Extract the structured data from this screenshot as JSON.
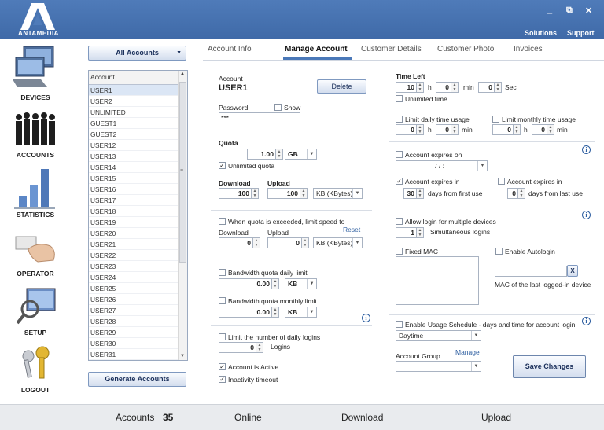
{
  "brand": {
    "logo_text": "ANTAMEDIA"
  },
  "window": {
    "minimize": "_",
    "restore": "⧉",
    "close": "✕"
  },
  "topnav": {
    "solutions": "Solutions",
    "support": "Support"
  },
  "sidebar": {
    "items": [
      {
        "label": "DEVICES",
        "icon": "computers-icon"
      },
      {
        "label": "ACCOUNTS",
        "icon": "people-icon"
      },
      {
        "label": "STATISTICS",
        "icon": "bar-chart-icon"
      },
      {
        "label": "OPERATOR",
        "icon": "hand-card-icon"
      },
      {
        "label": "SETUP",
        "icon": "magnifier-monitor-icon"
      },
      {
        "label": "LOGOUT",
        "icon": "keys-icon"
      }
    ]
  },
  "accounts": {
    "filter": "All Accounts",
    "column": "Account",
    "rows": [
      "USER1",
      "USER2",
      "UNLIMITED",
      "GUEST1",
      "GUEST2",
      "USER12",
      "USER13",
      "USER14",
      "USER15",
      "USER16",
      "USER17",
      "USER18",
      "USER19",
      "USER20",
      "USER21",
      "USER22",
      "USER23",
      "USER24",
      "USER25",
      "USER26",
      "USER27",
      "USER28",
      "USER29",
      "USER30",
      "USER31"
    ],
    "selected_index": 0,
    "generate": "Generate Accounts"
  },
  "tabs": [
    "Account Info",
    "Manage Account",
    "Customer Details",
    "Customer Photo",
    "Invoices"
  ],
  "form": {
    "account_label": "Account",
    "account_value": "USER1",
    "delete": "Delete",
    "password_label": "Password",
    "show_label": "Show",
    "password_value": "***",
    "quota_label": "Quota",
    "quota_value": "1.00",
    "quota_unit": "GB",
    "unlimited_quota": "Unlimited quota",
    "download_label": "Download",
    "upload_label": "Upload",
    "download_value": "100",
    "upload_value": "100",
    "speed_unit": "KB (KBytes)",
    "limit_speed": "When quota is exceeded, limit speed to",
    "reset": "Reset",
    "dl_label2": "Download",
    "ul_label2": "Upload",
    "dl_value2": "0",
    "ul_value2": "0",
    "speed_unit2": "KB (KBytes)",
    "bw_daily": "Bandwidth quota daily limit",
    "bw_daily_value": "0.00",
    "bw_daily_unit": "KB",
    "bw_monthly": "Bandwidth quota monthly limit",
    "bw_monthly_value": "0.00",
    "bw_monthly_unit": "KB",
    "limit_logins": "Limit the number of daily logins",
    "logins_value": "0",
    "logins_label": "Logins",
    "active": "Account is Active",
    "inactivity": "Inactivity timeout"
  },
  "right": {
    "time_left": "Time Left",
    "hours": "10",
    "h": "h",
    "mins": "0",
    "min": "min",
    "secs": "0",
    "sec": "Sec",
    "unlimited_time": "Unlimited time",
    "limit_daily": "Limit daily time usage",
    "limit_monthly": "Limit monthly time usage",
    "d_h": "0",
    "d_m": "0",
    "m_h": "0",
    "m_m": "0",
    "expires_on": "Account expires on",
    "expires_date": "/ /   : :",
    "expires_in": "Account expires in",
    "expires_in_value": "30",
    "days_first": "days from first use",
    "expires_in2": "Account expires in",
    "expires_in2_value": "0",
    "days_last": "days from last use",
    "multi_login": "Allow login for multiple devices",
    "multi_value": "1",
    "simultaneous": "Simultaneous logins",
    "fixed_mac": "Fixed MAC",
    "autologin": "Enable Autologin",
    "mac_clear": "X",
    "mac_last": "MAC of the last logged-in device",
    "usage_schedule": "Enable Usage Schedule - days and time for account login",
    "schedule_value": "Daytime",
    "group_label": "Account Group",
    "manage": "Manage",
    "save": "Save Changes"
  },
  "status": {
    "accounts_label": "Accounts",
    "accounts_count": "35",
    "online": "Online",
    "download": "Download",
    "upload": "Upload"
  }
}
